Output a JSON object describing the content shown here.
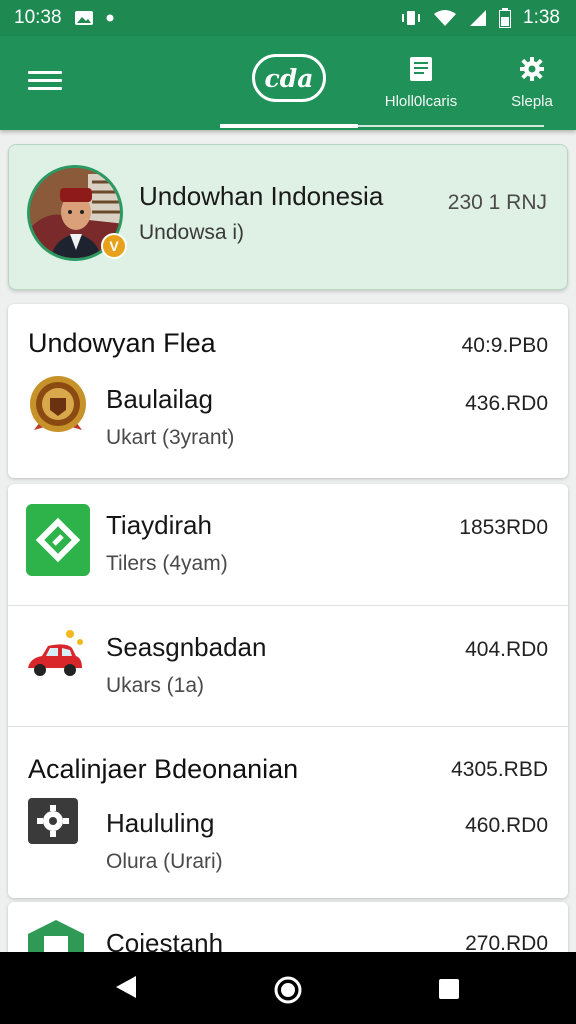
{
  "status_bar": {
    "time_left": "10:38",
    "time_right": "1:38"
  },
  "app_bar": {
    "logo_text": "cda",
    "tabs": [
      {
        "label": "Hloll0lcaris",
        "icon": "document-icon"
      },
      {
        "label": "Slepla",
        "icon": "gear-icon"
      }
    ]
  },
  "profile": {
    "name": "Undowhan Indonesia",
    "subtitle": "Undowsa i)",
    "amount": "230 1 RNJ",
    "badge": "V"
  },
  "sections": [
    {
      "title": "Undowyan Flea",
      "amount": "40:9.PB0",
      "items": [
        {
          "title": "Baulailag",
          "subtitle": "Ukart (3yrant)",
          "amount": "436.RD0",
          "icon": "seal-badge-icon"
        }
      ]
    },
    {
      "items": [
        {
          "title": "Tiaydirah",
          "subtitle": "Tilers (4yam)",
          "amount": "1853RD0",
          "icon": "green-tag-icon"
        },
        {
          "title": "Seasgnbadan",
          "subtitle": "Ukars (1a)",
          "amount": "404.RD0",
          "icon": "car-icon"
        }
      ]
    },
    {
      "title": "Acalinjaer Bdeonanian",
      "amount": "4305.RBD",
      "items": [
        {
          "title": "Haululing",
          "subtitle": "Olura (Urari)",
          "amount": "460.RD0",
          "icon": "dark-gear-icon"
        }
      ]
    },
    {
      "items": [
        {
          "title": "Coiestanh",
          "amount": "270.RD0",
          "icon": "green-box-icon"
        }
      ]
    }
  ],
  "colors": {
    "primary": "#1f9159",
    "status": "#1e8a52",
    "card_highlight": "#dff0e5"
  }
}
